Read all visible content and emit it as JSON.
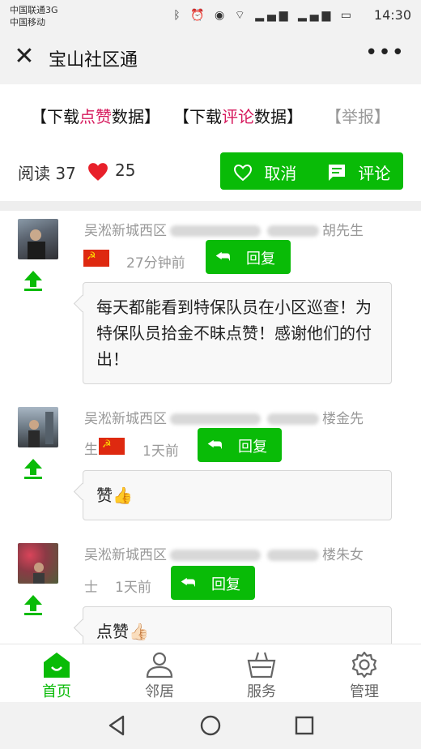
{
  "status_bar": {
    "carrier1": "中国联通3G",
    "carrier2": "中国移动",
    "icons": [
      "bluetooth-icon",
      "alarm-icon",
      "eye-icon",
      "wifi-icon",
      "signal-3g-icon",
      "signal-e-icon",
      "battery-icon"
    ],
    "time": "14:30"
  },
  "header": {
    "title": "宝山社区通"
  },
  "downloads": {
    "a_prefix": "【下载",
    "a_highlight": "点赞",
    "a_suffix": "数据】",
    "b_prefix": "【下载",
    "b_highlight": "评论",
    "b_suffix": "数据】",
    "report": "【举报】"
  },
  "stats": {
    "read_label": "阅读",
    "read_count": "37",
    "likes": "25",
    "cancel_label": "取消",
    "comment_label": "评论"
  },
  "comments": [
    {
      "area": "吴淞新城西区",
      "name_tail": "胡先生",
      "time": "27分钟前",
      "reply": "回复",
      "text": "每天都能看到特保队员在小区巡查！为特保队员拾金不昧点赞！感谢他们的付出！"
    },
    {
      "area": "吴淞新城西区",
      "name_tail": "楼金先",
      "name_wrap": "生",
      "time": "1天前",
      "reply": "回复",
      "text": "赞👍"
    },
    {
      "area": "吴淞新城西区",
      "name_tail": "楼朱女",
      "name_wrap": "士",
      "time": "1天前",
      "reply": "回复",
      "text": "点赞👍🏻"
    }
  ],
  "nav": [
    {
      "label": "首页",
      "icon": "home-icon",
      "active": true
    },
    {
      "label": "邻居",
      "icon": "person-icon",
      "active": false
    },
    {
      "label": "服务",
      "icon": "basket-icon",
      "active": false
    },
    {
      "label": "管理",
      "icon": "gear-icon",
      "active": false
    }
  ],
  "colors": {
    "accent": "#09bb07",
    "highlight": "#d6185c",
    "heart": "#e8202a"
  }
}
